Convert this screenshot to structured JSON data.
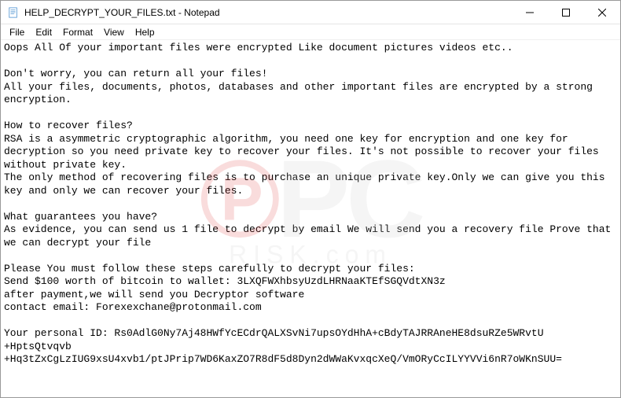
{
  "titlebar": {
    "title": "HELP_DECRYPT_YOUR_FILES.txt - Notepad"
  },
  "window_controls": {
    "minimize": "—",
    "maximize": "☐",
    "close": "✕"
  },
  "menubar": {
    "file": "File",
    "edit": "Edit",
    "format": "Format",
    "view": "View",
    "help": "Help"
  },
  "content": "Oops All Of your important files were encrypted Like document pictures videos etc..\n\nDon't worry, you can return all your files!\nAll your files, documents, photos, databases and other important files are encrypted by a strong encryption.\n\nHow to recover files?\nRSA is a asymmetric cryptographic algorithm, you need one key for encryption and one key for decryption so you need private key to recover your files. It's not possible to recover your files without private key.\nThe only method of recovering files is to purchase an unique private key.Only we can give you this key and only we can recover your files.\n\nWhat guarantees you have?\nAs evidence, you can send us 1 file to decrypt by email We will send you a recovery file Prove that we can decrypt your file\n\nPlease You must follow these steps carefully to decrypt your files:\nSend $100 worth of bitcoin to wallet: 3LXQFWXhbsyUzdLHRNaaKTEfSGQVdtXN3z\nafter payment,we will send you Decryptor software\ncontact email: Forexexchane@protonmail.com\n\nYour personal ID: Rs0AdlG0Ny7Aj48HWfYcECdrQALXSvNi7upsOYdHhA+cBdyTAJRRAneHE8dsuRZe5WRvtU\n+HptsQtvqvb\n+Hq3tZxCgLzIUG9xsU4xvb1/ptJPrip7WD6KaxZO7R8dF5d8Dyn2dWWaKvxqcXeQ/VmORyCcILYYVVi6nR7oWKnSUU=",
  "watermark": {
    "main": "PC",
    "sub": "RISK.com"
  }
}
